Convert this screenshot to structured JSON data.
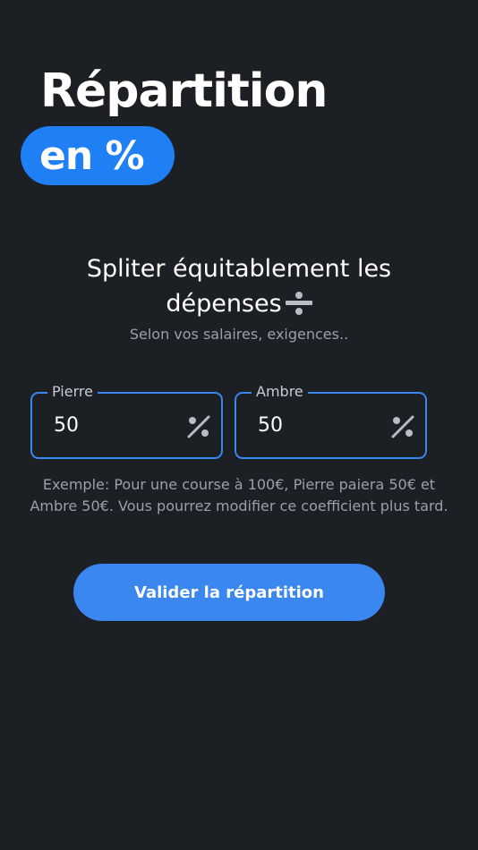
{
  "header": {
    "title": "Répartition",
    "badge": "en %"
  },
  "intro": {
    "heading_line1": "Spliter équitablement les",
    "heading_line2": "dépenses",
    "heading_icon": "division-icon",
    "subtitle": "Selon vos salaires, exigences.."
  },
  "fields": [
    {
      "label": "Pierre",
      "value": "50",
      "icon": "percent-icon"
    },
    {
      "label": "Ambre",
      "value": "50",
      "icon": "percent-icon"
    }
  ],
  "help_text": "Exemple: Pour une course à 100€, Pierre paiera  50€ et Ambre 50€. Vous pourrez modifier ce coefficient plus tard.",
  "actions": {
    "submit_label": "Valider la répartition"
  },
  "colors": {
    "background": "#1c1f24",
    "accent": "#3a87f0",
    "badge": "#1f7ff5",
    "muted_text": "#9aa0a8"
  }
}
